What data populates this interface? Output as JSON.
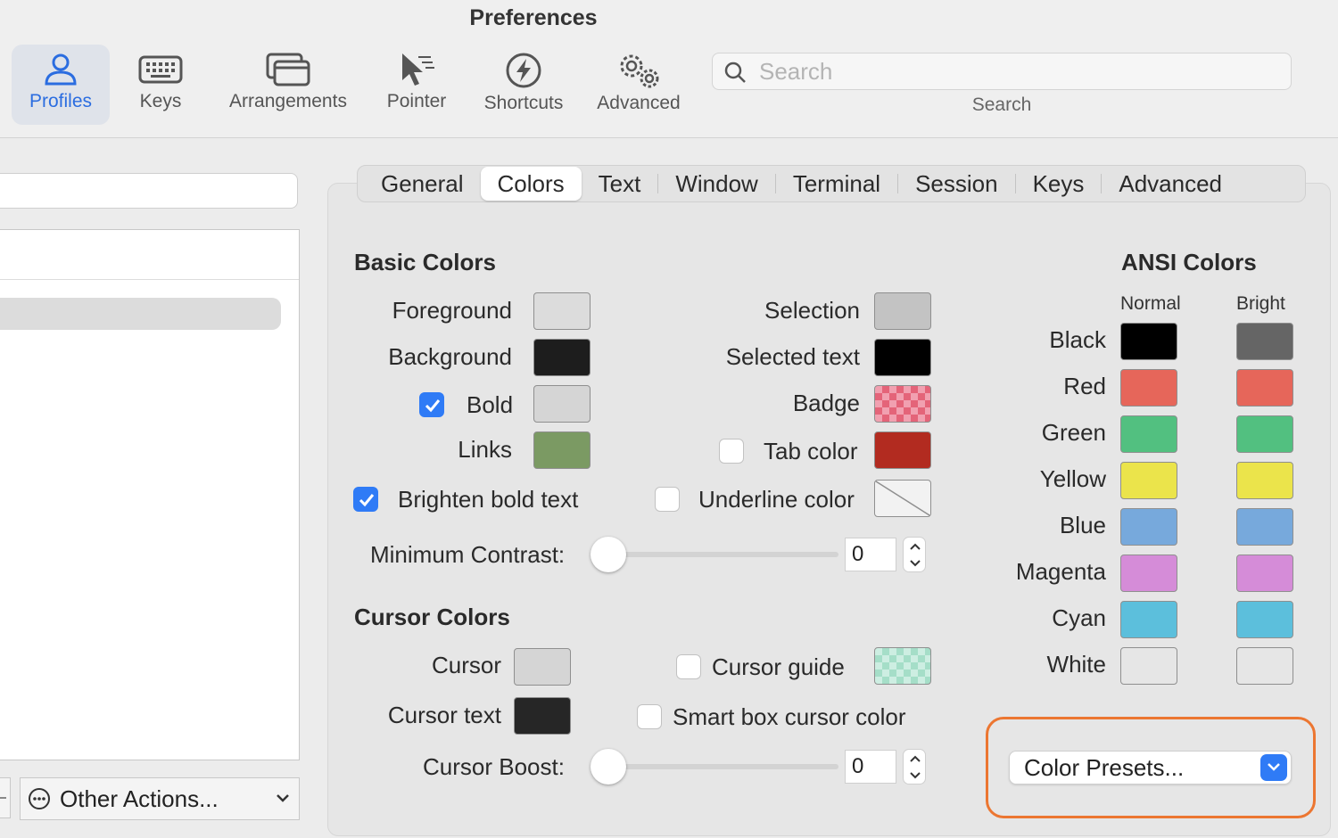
{
  "window": {
    "title": "Preferences"
  },
  "toolbar": {
    "items": [
      {
        "label": "Profiles",
        "icon": "person-icon",
        "active": true
      },
      {
        "label": "Keys",
        "icon": "keyboard-icon"
      },
      {
        "label": "Arrangements",
        "icon": "windows-icon"
      },
      {
        "label": "Pointer",
        "icon": "pointer-icon"
      },
      {
        "label": "Shortcuts",
        "icon": "bolt-icon"
      },
      {
        "label": "Advanced",
        "icon": "gears-icon"
      }
    ],
    "search": {
      "placeholder": "Search",
      "caption": "Search"
    }
  },
  "sidebar": {
    "other_actions_label": "Other Actions..."
  },
  "tabs": [
    "General",
    "Colors",
    "Text",
    "Window",
    "Terminal",
    "Session",
    "Keys",
    "Advanced"
  ],
  "active_tab": "Colors",
  "basic_colors": {
    "title": "Basic Colors",
    "foreground": {
      "label": "Foreground",
      "color": "#dcdcdc"
    },
    "background": {
      "label": "Background",
      "color": "#1d1d1d"
    },
    "bold": {
      "label": "Bold",
      "color": "#d5d5d5",
      "checked": true
    },
    "links": {
      "label": "Links",
      "color": "#7b9a63"
    },
    "selection": {
      "label": "Selection",
      "color": "#c3c3c3"
    },
    "selected_text": {
      "label": "Selected text",
      "color": "#000000"
    },
    "badge": {
      "label": "Badge",
      "color": "#f1a0b0"
    },
    "tab_color": {
      "label": "Tab color",
      "color": "#b22b20",
      "checked": false
    },
    "underline_color": {
      "label": "Underline color",
      "checked": false
    },
    "brighten_bold": {
      "label": "Brighten bold text",
      "checked": true
    },
    "min_contrast": {
      "label": "Minimum Contrast:",
      "value": "0"
    }
  },
  "cursor_colors": {
    "title": "Cursor Colors",
    "cursor": {
      "label": "Cursor",
      "color": "#d5d5d5"
    },
    "cursor_text": {
      "label": "Cursor text",
      "color": "#262626"
    },
    "cursor_guide": {
      "label": "Cursor guide",
      "color": "#cdeee2",
      "checked": false
    },
    "smart_box": {
      "label": "Smart box cursor color",
      "checked": false
    },
    "boost": {
      "label": "Cursor Boost:",
      "value": "0"
    }
  },
  "ansi": {
    "title": "ANSI Colors",
    "normal_header": "Normal",
    "bright_header": "Bright",
    "rows": [
      {
        "name": "Black",
        "normal": "#000000",
        "bright": "#656565"
      },
      {
        "name": "Red",
        "normal": "#e6665a",
        "bright": "#e6665a"
      },
      {
        "name": "Green",
        "normal": "#52c080",
        "bright": "#52c080"
      },
      {
        "name": "Yellow",
        "normal": "#ebe44b",
        "bright": "#ebe44b"
      },
      {
        "name": "Blue",
        "normal": "#77a9dc",
        "bright": "#77a9dc"
      },
      {
        "name": "Magenta",
        "normal": "#d58cd8",
        "bright": "#d58cd8"
      },
      {
        "name": "Cyan",
        "normal": "#5cbfdc",
        "bright": "#5cbfdc"
      },
      {
        "name": "White",
        "normal": "#e6e6e6",
        "bright": "#e6e6e6"
      }
    ]
  },
  "presets": {
    "label": "Color Presets..."
  },
  "colors": {
    "accent": "#2f7bf6",
    "highlight": "#ec7631"
  }
}
